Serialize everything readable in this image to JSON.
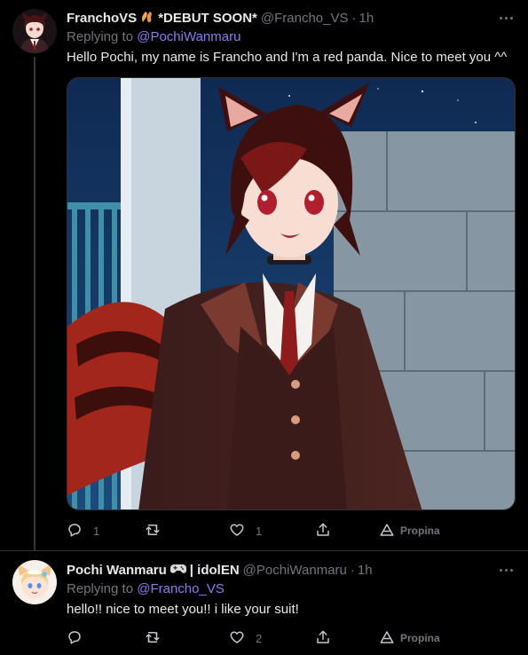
{
  "tweets": [
    {
      "author_name": "FranchoVS",
      "author_suffix": "*DEBUT SOON*",
      "name_emoji": "clapping-hands-emoji",
      "handle": "@Francho_VS",
      "dot": "·",
      "time": "1h",
      "replying_label": "Replying to",
      "replying_to": "@PochiWanmaru",
      "text": "Hello Pochi, my name is Francho and I'm a red panda. Nice to meet you ^^",
      "replies": "1",
      "retweets": "",
      "likes": "1",
      "tip_label": "Propina"
    },
    {
      "author_name": "Pochi Wanmaru",
      "author_suffix": "| idolEN",
      "name_emoji": "game-controller-emoji",
      "handle": "@PochiWanmaru",
      "dot": "·",
      "time": "1h",
      "replying_label": "Replying to",
      "replying_to": "@Francho_VS",
      "text": "hello!! nice to meet you!! i like your suit!",
      "replies": "",
      "retweets": "",
      "likes": "2",
      "tip_label": "Propina"
    }
  ],
  "colors": {
    "background": "#000000",
    "text": "#e7e9ea",
    "muted": "#71767b",
    "mention": "#8a7cf5",
    "divider": "#2f3336"
  }
}
